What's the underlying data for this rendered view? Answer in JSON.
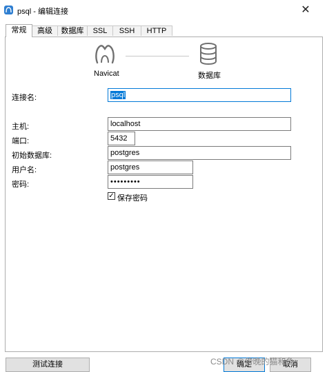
{
  "window": {
    "title": "psql - 编辑连接",
    "close": "✕"
  },
  "tabs": [
    {
      "label": "常规",
      "active": true
    },
    {
      "label": "高级"
    },
    {
      "label": "数据库"
    },
    {
      "label": "SSL"
    },
    {
      "label": "SSH"
    },
    {
      "label": "HTTP"
    }
  ],
  "diagram": {
    "left_label": "Navicat",
    "right_label": "数据库"
  },
  "form": {
    "connection_name": {
      "label": "连接名:",
      "value": "psql"
    },
    "host": {
      "label": "主机:",
      "value": "localhost"
    },
    "port": {
      "label": "端口:",
      "value": "5432"
    },
    "initial_db": {
      "label": "初始数据库:",
      "value": "postgres"
    },
    "username": {
      "label": "用户名:",
      "value": "postgres"
    },
    "password": {
      "label": "密码:",
      "value": "•••••••••"
    },
    "save_password": {
      "label": "保存密码",
      "checked": true,
      "mark": "✓"
    }
  },
  "buttons": {
    "test": "测试连接",
    "ok": "确定",
    "cancel": "取消"
  },
  "watermark": "CSDN @傍晚的猫和鱼"
}
